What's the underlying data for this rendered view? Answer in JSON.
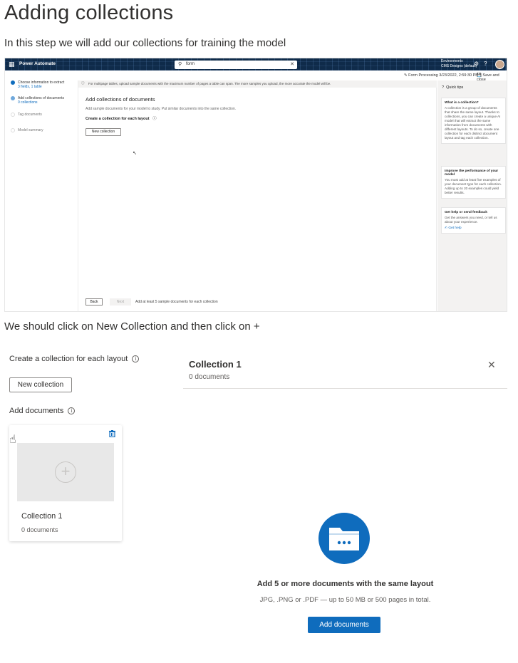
{
  "page": {
    "title": "Adding collections",
    "intro": "In this step we will add our collections for training the model",
    "instruction": "We should click on New Collection and then click on +"
  },
  "screenshot1": {
    "topbar": {
      "brand": "Power Automate",
      "search_value": "form",
      "env_line1": "Environments",
      "env_line2": "CMS Designs (default)"
    },
    "subbar": {
      "form_label": "Form Processing 3/23/2022, 2:59:30 PM",
      "save_label": "Save and close"
    },
    "steps": [
      {
        "label": "Choose information to extract",
        "sub": "3 fields, 1 table",
        "state": "done"
      },
      {
        "label": "Add collections of documents",
        "sub": "0 collections",
        "state": "current"
      },
      {
        "label": "Tag documents",
        "sub": "",
        "state": "todo"
      },
      {
        "label": "Model summary",
        "sub": "",
        "state": "todo"
      }
    ],
    "info_bar": "For multipage tables, upload sample documents with the maximum number of pages a table can span. The more samples you upload, the more accurate the model will be.",
    "heading": "Add collections of documents",
    "description": "Add sample documents for your model to study. Put similar documents into the same collection.",
    "subheading": "Create a collection for each layout",
    "new_collection_label": "New collection",
    "footer": {
      "back": "Back",
      "next": "Next",
      "note": "Add at least 5 sample documents for each collection"
    },
    "quick_tips": {
      "title": "Quick tips",
      "cards": [
        {
          "title": "What is a collection?",
          "body": "A collection is a group of documents that share the same layout. Thanks to collections, you can create a unique AI model that will extract the same information from documents with different layouts. To do so, create one collection for each distinct document layout and tag each collection.",
          "link": ""
        },
        {
          "title": "Improve the performance of your model",
          "body": "You must add at least five examples of your document type for each collection. Adding up to 20 examples could yield better results.",
          "link": ""
        },
        {
          "title": "Get help or send feedback",
          "body": "Get the answers you need, or tell us about your experience.",
          "link": "Get help"
        }
      ]
    }
  },
  "screenshot2": {
    "left": {
      "create_title": "Create a collection for each layout",
      "new_collection_label": "New collection",
      "add_documents_title": "Add documents",
      "card": {
        "name": "Collection 1",
        "count": "0 documents"
      }
    },
    "right": {
      "title": "Collection 1",
      "count": "0 documents",
      "empty_title": "Add 5 or more documents with the same layout",
      "empty_sub": "JPG, .PNG or .PDF — up to 50 MB or 500 pages in total.",
      "add_documents_label": "Add documents"
    }
  },
  "colors": {
    "accent": "#0f6cbd",
    "topbar": "#0f2b4a",
    "text": "#323130"
  }
}
